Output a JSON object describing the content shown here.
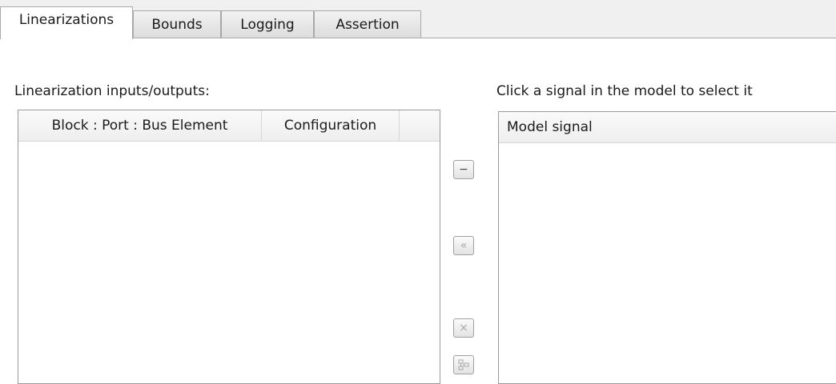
{
  "tabs": [
    {
      "label": "Linearizations",
      "active": true
    },
    {
      "label": "Bounds",
      "active": false
    },
    {
      "label": "Logging",
      "active": false
    },
    {
      "label": "Assertion",
      "active": false
    }
  ],
  "left_panel": {
    "label": "Linearization inputs/outputs:",
    "columns": [
      "Block : Port : Bus Element",
      "Configuration"
    ],
    "rows": []
  },
  "right_panel": {
    "label": "Click a signal in the model to select it",
    "columns": [
      "Model signal"
    ],
    "rows": []
  },
  "buttons": {
    "remove_icon": "minus-icon",
    "add_icon": "double-chevron-left-icon",
    "delete_icon": "x-icon",
    "highlight_icon": "highlight-block-icon"
  }
}
